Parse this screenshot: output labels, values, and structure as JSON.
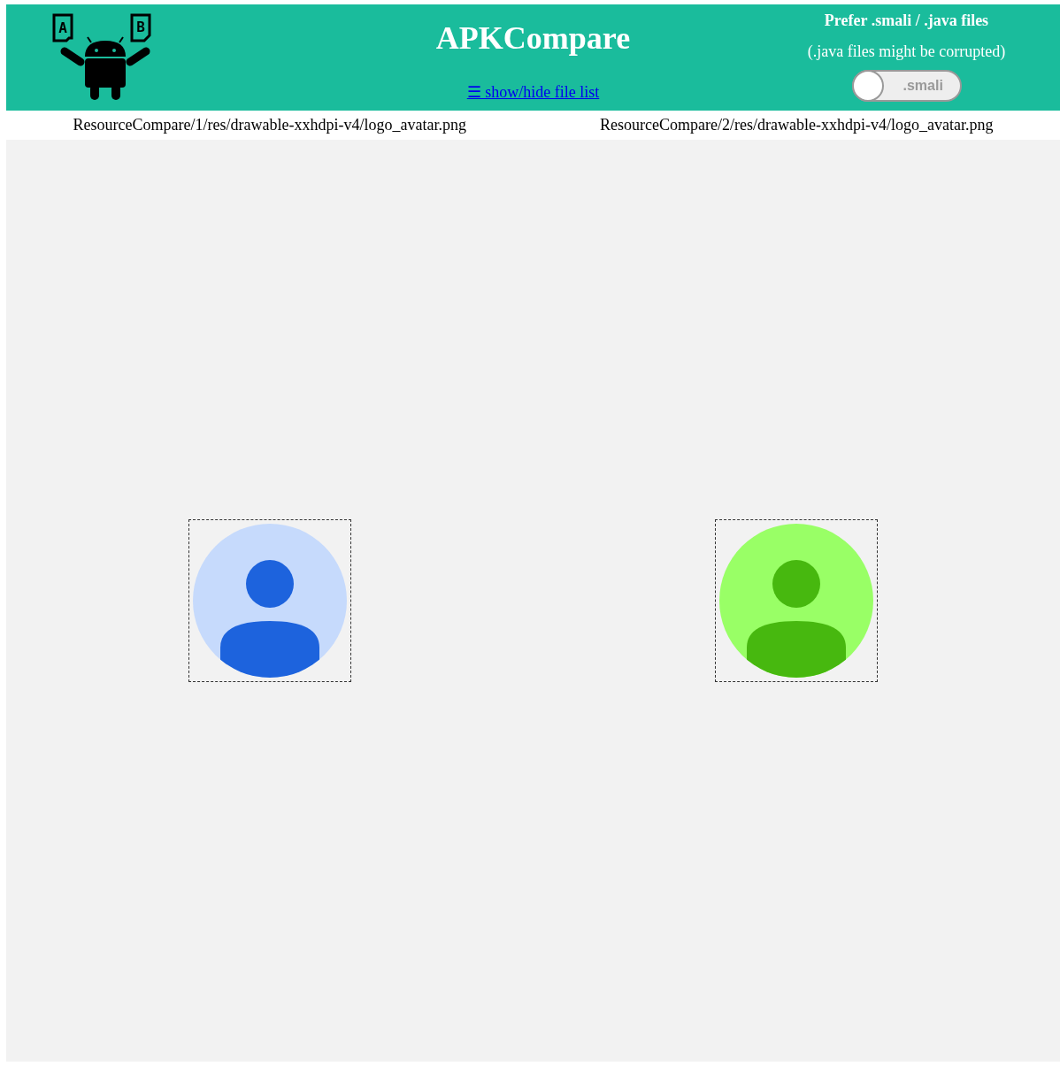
{
  "header": {
    "logo_letters": [
      "A",
      "B"
    ],
    "title": "APKCompare",
    "file_list_link": "☰ show/hide file list",
    "preference": {
      "heading": "Prefer .smali / .java files",
      "note": "(.java files might be corrupted)",
      "toggle": {
        "label": ".smali",
        "on": false
      }
    }
  },
  "panes": [
    {
      "path": "ResourceCompare/1/res/drawable-xxhdpi-v4/logo_avatar.png",
      "color": "#c6dafc"
    },
    {
      "path": "ResourceCompare/2/res/drawable-xxhdpi-v4/logo_avatar.png",
      "color": "#99ff66"
    }
  ]
}
